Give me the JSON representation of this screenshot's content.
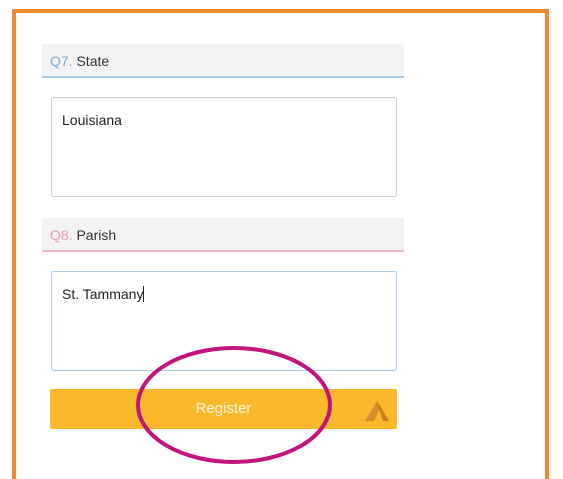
{
  "form": {
    "q7": {
      "number": "Q7.",
      "label": "State",
      "value": "Louisiana"
    },
    "q8": {
      "number": "Q8.",
      "label": "Parish",
      "value_prefix": "St. ",
      "value_suffix": "Tammany"
    },
    "register_label": "Register"
  },
  "icons": {
    "register_arrow": "arrow-up-icon",
    "highlight": "highlight-ellipse"
  },
  "colors": {
    "frame_border": "#ef8a2c",
    "button": "#fbb82d",
    "q7_accent": "#7aa8d8",
    "q8_accent": "#f09ab1",
    "ellipse": "#c3137d"
  }
}
